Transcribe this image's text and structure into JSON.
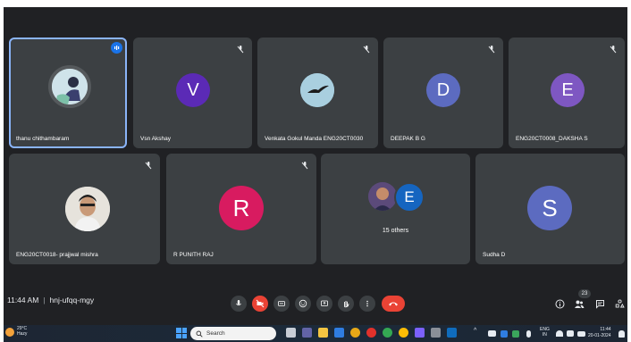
{
  "meeting": {
    "time": "11:44 AM",
    "separator": "|",
    "code": "hnj-ufqq-mgy",
    "participant_count": "23"
  },
  "participants_row1": [
    {
      "name": "thanu chithambaram",
      "avatar_type": "photo",
      "active": true
    },
    {
      "name": "Vsn Akshay",
      "initial": "V",
      "color": "#5b2ab6"
    },
    {
      "name": "Venkata Gokul Manda ENG20CT0030",
      "avatar_type": "photo-bird"
    },
    {
      "name": "DEEPAK B G",
      "initial": "D",
      "color": "#5c6bc0"
    },
    {
      "name": "ENG20CT0008_DAKSHA S",
      "initial": "E",
      "color": "#7e57c2"
    }
  ],
  "participants_row2": [
    {
      "name": "ENG20CT0018- prajjwal mishra",
      "avatar_type": "photo-person"
    },
    {
      "name": "R PUNITH RAJ",
      "initial": "R",
      "color": "#d81b60"
    },
    {
      "name": "15 others",
      "initial": "E",
      "color": "#1565c0",
      "group": true
    },
    {
      "name": "Sudha D",
      "initial": "S",
      "color": "#5c6bc0"
    }
  ],
  "controls": [
    "mic-icon",
    "camera-off-icon",
    "captions-icon",
    "emoji-icon",
    "present-icon",
    "raise-hand-icon",
    "more-options-icon",
    "end-call-icon"
  ],
  "right_controls": [
    "info-icon",
    "people-icon",
    "chat-icon",
    "activities-icon"
  ],
  "taskbar": {
    "weather_temp": "29°C",
    "weather_desc": "Hazy",
    "search_placeholder": "Search",
    "lang_top": "ENG",
    "lang_bottom": "IN",
    "time": "11:44",
    "date": "20-01-2024"
  },
  "colors": {
    "meet_bg": "#202124",
    "tile_bg": "#3c4043",
    "end_call": "#ea4335",
    "speaking": "#1a73e8"
  }
}
